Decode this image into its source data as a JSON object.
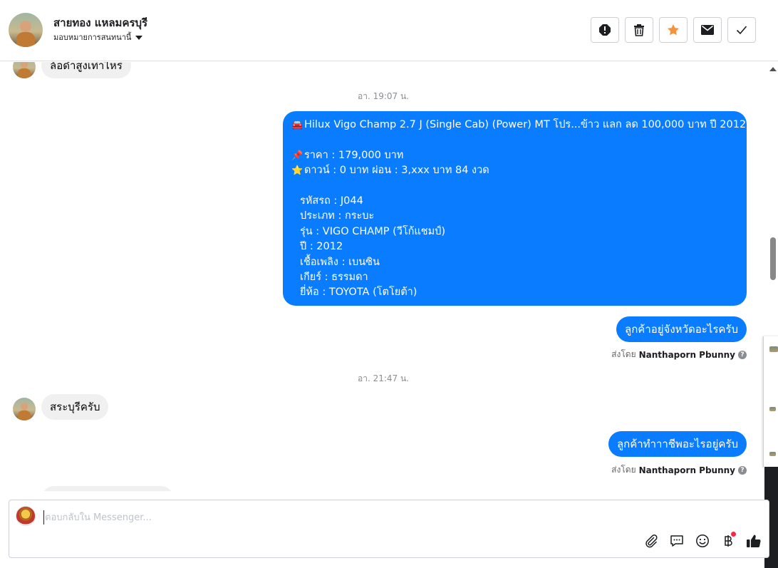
{
  "header": {
    "contact_name": "สายทอง แหลมครบุรี",
    "assign_label": "มอบหมายการสนทนานี้",
    "actions": [
      {
        "name": "spam-icon",
        "label": "!"
      },
      {
        "name": "trash-icon",
        "label": ""
      },
      {
        "name": "star-icon",
        "label": ""
      },
      {
        "name": "envelope-icon",
        "label": ""
      },
      {
        "name": "check-icon",
        "label": ""
      }
    ],
    "accent_star": "#f7923b"
  },
  "thread": {
    "partial_top_message": "ล้อดำสูงเท่าไหร่",
    "timestamp_1": "อา. 19:07 น.",
    "listing": {
      "title_emoji": "🚘",
      "title": "Hilux Vigo Champ 2.7 J (Single Cab) (Power) MT โปร...ข้าว แลก ลด 100,000 บาท ปี 2012",
      "price_emoji": "📌",
      "price": "ราคา : 179,000 บาท",
      "down_emoji": "⭐",
      "down": "ดาวน์ : 0 บาท ผ่อน : 3,xxx บาท 84 งวด",
      "details": [
        "รหัสรถ : J044",
        "ประเภท : กระบะ",
        "รุ่น : VIGO CHAMP (วีโก้แชมป์)",
        "ปี : 2012",
        "เชื้อเพลิง : เบนซิน",
        "เกียร์ : ธรรมดา",
        "ยี่ห้อ : TOYOTA (โตโยต้า)"
      ]
    },
    "out_msg_1": "ลูกค้าอยู่จังหวัดอะไรครับ",
    "sent_by_prefix": "ส่งโดย",
    "sent_by_name": "Nanthaporn Pbunny",
    "timestamp_2": "อา. 21:47 น.",
    "in_msg_2": "สระบุรีครับ",
    "out_msg_2": "ลูกค้าทำาาชีพอะไรอยู่ครับ"
  },
  "composer": {
    "placeholder": "ตอบกลับใน Messenger...",
    "tools": [
      "attachment-icon",
      "saved-reply-icon",
      "emoji-icon",
      "baht-icon",
      "like-icon"
    ]
  },
  "colors": {
    "outgoing_bubble": "#0a7cff",
    "incoming_bubble": "#f0f0f0",
    "notification_dot": "#f02849"
  }
}
